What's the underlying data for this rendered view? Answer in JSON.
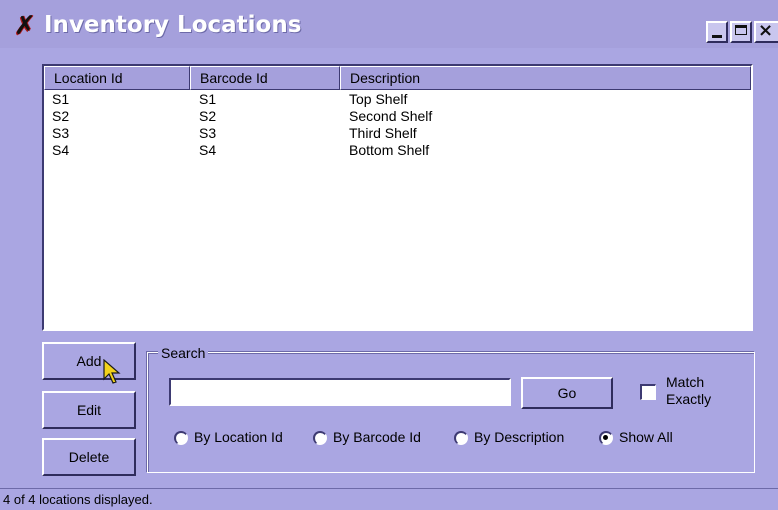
{
  "window": {
    "title": "Inventory Locations",
    "icon": "x-app-icon",
    "controls": {
      "minimize": "minimize-icon",
      "maximize": "maximize-icon",
      "close": "×"
    }
  },
  "list": {
    "columns": [
      "Location Id",
      "Barcode Id",
      "Description"
    ],
    "rows": [
      [
        "S1",
        "S1",
        "Top Shelf"
      ],
      [
        "S2",
        "S2",
        "Second Shelf"
      ],
      [
        "S3",
        "S3",
        "Third Shelf"
      ],
      [
        "S4",
        "S4",
        "Bottom Shelf"
      ]
    ]
  },
  "buttons": {
    "add": "Add",
    "edit": "Edit",
    "delete": "Delete",
    "go": "Go"
  },
  "search": {
    "group_label": "Search",
    "input_value": "",
    "match_exactly_label": "Match Exactly",
    "match_exactly_checked": false,
    "options": [
      {
        "label": "By Location Id",
        "checked": false
      },
      {
        "label": "By Barcode Id",
        "checked": false
      },
      {
        "label": "By Description",
        "checked": false
      },
      {
        "label": "Show All",
        "checked": true
      }
    ]
  },
  "status": {
    "text": "4 of 4 locations displayed."
  },
  "colors": {
    "window_bg": "#aaa6e2",
    "title_text": "#ffffff",
    "list_bg": "#ffffff"
  }
}
